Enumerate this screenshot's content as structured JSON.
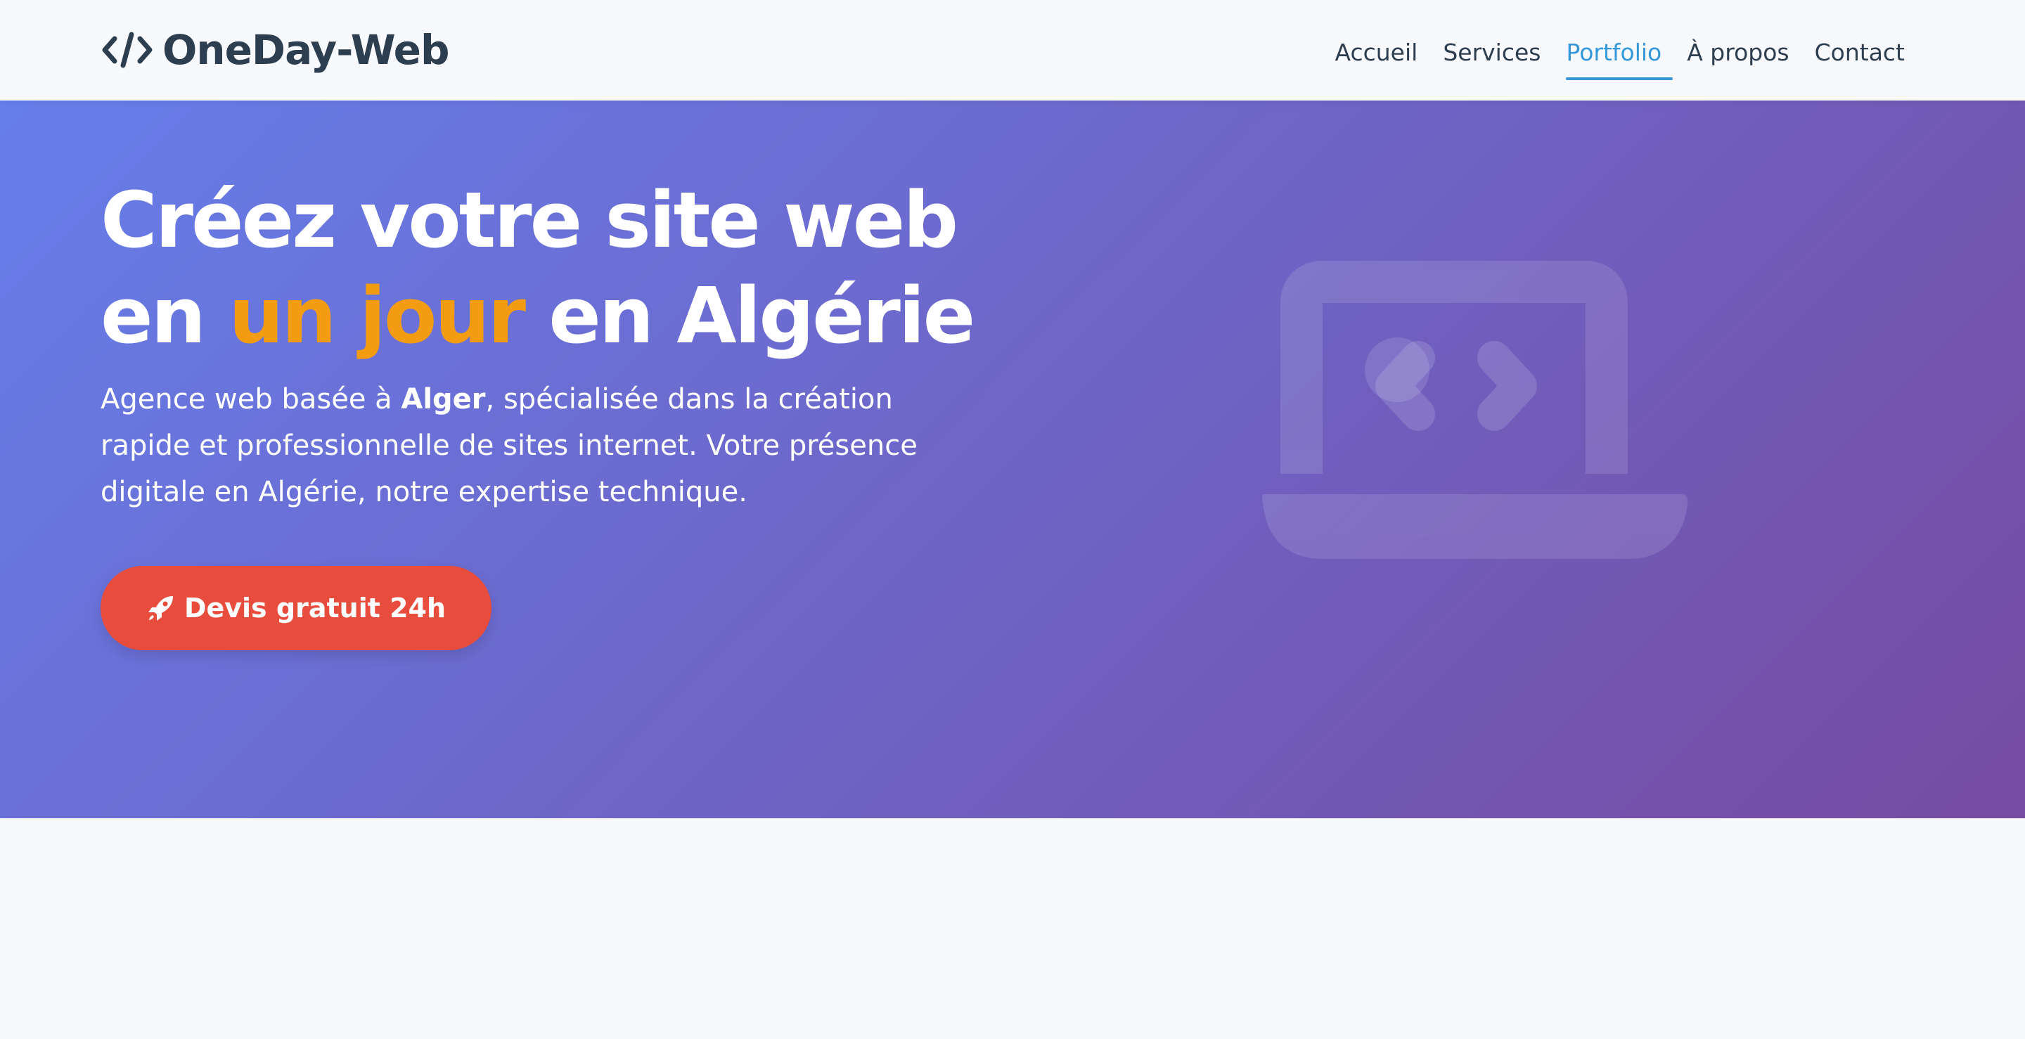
{
  "brand": {
    "name": "OneDay-Web",
    "icon": "code-icon",
    "color": "#2c3e50"
  },
  "nav": {
    "items": [
      {
        "label": "Accueil",
        "active": false
      },
      {
        "label": "Services",
        "active": false
      },
      {
        "label": "Portfolio",
        "active": true
      },
      {
        "label": "À propos",
        "active": false
      },
      {
        "label": "Contact",
        "active": false
      }
    ],
    "active_color": "#3498db"
  },
  "hero": {
    "title_line1": "Créez votre site web",
    "title_line2_prefix": "en ",
    "title_line2_accent": "un jour",
    "title_line2_suffix": " en Algérie",
    "description_prefix": "Agence web basée à ",
    "description_bold": "Alger",
    "description_suffix": ", spécialisée dans la création rapide et professionnelle de sites internet. Votre présence digitale en Algérie, notre expertise technique.",
    "cta_label": "Devis gratuit 24h",
    "cta_icon": "rocket-icon",
    "illustration_icon": "laptop-code-icon",
    "gradient_start": "#667eea",
    "gradient_end": "#764ba2",
    "accent_color": "#f39c12",
    "cta_color": "#e74c3c"
  }
}
